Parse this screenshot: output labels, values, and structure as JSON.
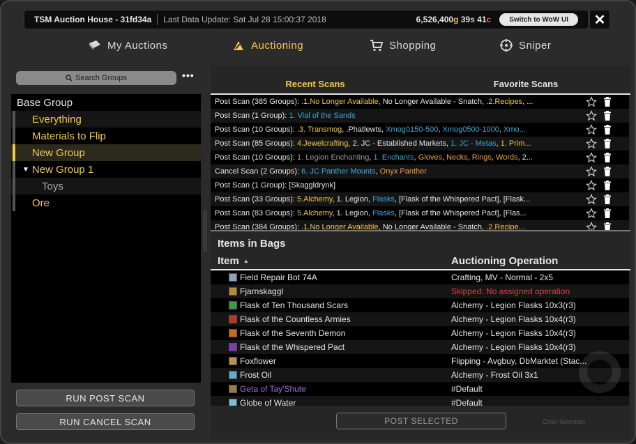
{
  "title_bar": {
    "app_title": "TSM Auction House - 31fd34a",
    "last_update": "Last Data Update: Sat Jul 28 15:00:37 2018",
    "gold_amount": "6,526,400",
    "gold_unit": "g",
    "silver_amount": "39",
    "silver_unit": "s",
    "copper_amount": "41",
    "copper_unit": "c",
    "switch_label": "Switch to WoW UI",
    "close_label": "✕"
  },
  "nav": {
    "tabs": [
      {
        "label": "My Auctions",
        "icon": "mail-icon",
        "active": false
      },
      {
        "label": "Auctioning",
        "icon": "gavel-icon",
        "active": true
      },
      {
        "label": "Shopping",
        "icon": "cart-icon",
        "active": false
      },
      {
        "label": "Sniper",
        "icon": "crosshair-icon",
        "active": false
      }
    ]
  },
  "groups": {
    "search_placeholder": "Search Groups",
    "more_label": "•••",
    "items": [
      {
        "label": "Base Group"
      },
      {
        "label": "Everything"
      },
      {
        "label": "Materials to Flip"
      },
      {
        "label": "New Group"
      },
      {
        "label": "New Group 1"
      },
      {
        "label": "Toys"
      },
      {
        "label": "Ore"
      }
    ]
  },
  "actions": {
    "run_post_scan": "RUN POST SCAN",
    "run_cancel_scan": "RUN CANCEL SCAN"
  },
  "scans": {
    "tabs": [
      "Recent Scans",
      "Favorite Scans"
    ],
    "rows": [
      {
        "segments": [
          {
            "t": "Post Scan (385 Groups): ",
            "c": "w"
          },
          {
            "t": ".1.No Longer Available",
            "c": "y"
          },
          {
            "t": ", No Longer Available - Snatch, ",
            "c": "w"
          },
          {
            "t": ".2.Recipes",
            "c": "y"
          },
          {
            "t": ", ...",
            "c": "w"
          }
        ]
      },
      {
        "segments": [
          {
            "t": "Post Scan (1 Group): ",
            "c": "w"
          },
          {
            "t": "1. Vial of the Sands",
            "c": "b"
          }
        ]
      },
      {
        "segments": [
          {
            "t": "Post Scan (10 Groups): ",
            "c": "w"
          },
          {
            "t": ".3. Transmog",
            "c": "y"
          },
          {
            "t": ", .Phatlewts, ",
            "c": "w"
          },
          {
            "t": "Xmog0150-500",
            "c": "b"
          },
          {
            "t": ", ",
            "c": "w"
          },
          {
            "t": "Xmog0500-1000",
            "c": "b"
          },
          {
            "t": ", ",
            "c": "w"
          },
          {
            "t": "Xmo...",
            "c": "b"
          }
        ]
      },
      {
        "segments": [
          {
            "t": "Post Scan (85 Groups): ",
            "c": "w"
          },
          {
            "t": "4.Jewelcrafting",
            "c": "y"
          },
          {
            "t": ", 2. JC - Established Markets, ",
            "c": "w"
          },
          {
            "t": "1. JC - Metas",
            "c": "b"
          },
          {
            "t": ", ",
            "c": "w"
          },
          {
            "t": "1. Prim...",
            "c": "y"
          }
        ]
      },
      {
        "segments": [
          {
            "t": "Post Scan (10 Groups): ",
            "c": "w"
          },
          {
            "t": "1. Legion Enchanting",
            "c": "g"
          },
          {
            "t": ", ",
            "c": "w"
          },
          {
            "t": "1. Enchants",
            "c": "b"
          },
          {
            "t": ", ",
            "c": "w"
          },
          {
            "t": "Gloves",
            "c": "o"
          },
          {
            "t": ", ",
            "c": "w"
          },
          {
            "t": "Necks",
            "c": "o"
          },
          {
            "t": ", ",
            "c": "w"
          },
          {
            "t": "Rings",
            "c": "o"
          },
          {
            "t": ", ",
            "c": "w"
          },
          {
            "t": "Words",
            "c": "o"
          },
          {
            "t": ", 2...",
            "c": "w"
          }
        ]
      },
      {
        "segments": [
          {
            "t": "Cancel Scan (2 Groups): ",
            "c": "w"
          },
          {
            "t": "6. JC Panther Mounts",
            "c": "b"
          },
          {
            "t": ", ",
            "c": "w"
          },
          {
            "t": "Onyx Panther",
            "c": "o"
          }
        ]
      },
      {
        "segments": [
          {
            "t": "Post Scan (1 Group): [Skaggldrynk]",
            "c": "w"
          }
        ]
      },
      {
        "segments": [
          {
            "t": "Post Scan (33 Groups): ",
            "c": "w"
          },
          {
            "t": "5.Alchemy",
            "c": "y"
          },
          {
            "t": ", 1. Legion, ",
            "c": "w"
          },
          {
            "t": "Flasks",
            "c": "b"
          },
          {
            "t": ", [Flask of the Whispered Pact], [Flask...",
            "c": "w"
          }
        ]
      },
      {
        "segments": [
          {
            "t": "Post Scan (83 Groups): ",
            "c": "w"
          },
          {
            "t": "5.Alchemy",
            "c": "y"
          },
          {
            "t": ", 1. Legion, ",
            "c": "w"
          },
          {
            "t": "Flasks",
            "c": "b"
          },
          {
            "t": ", [Flask of the Whispered Pact], [Flas...",
            "c": "w"
          }
        ]
      },
      {
        "segments": [
          {
            "t": "Post Scan (384 Groups): ",
            "c": "w"
          },
          {
            "t": ".1.No Longer Available",
            "c": "y"
          },
          {
            "t": ", No Longer Available - Snatch, ",
            "c": "w"
          },
          {
            "t": ".2.Recipe...",
            "c": "y"
          }
        ]
      }
    ]
  },
  "items": {
    "title": "Items in Bags",
    "col_item": "Item",
    "col_operation": "Auctioning Operation",
    "rows": [
      {
        "name": "Field Repair Bot 74A",
        "operation": "Crafting, MV - Normal - 2x5",
        "icon_color": "#8fa3c0"
      },
      {
        "name": "Fjarnskaggl",
        "operation": "Skipped: No assigned operation",
        "icon_color": "#b58a3a",
        "error": true
      },
      {
        "name": "Flask of Ten Thousand Scars",
        "operation": "Alchemy - Legion Flasks 10x3(r3)",
        "icon_color": "#3a9a4a"
      },
      {
        "name": "Flask of the Countless Armies",
        "operation": "Alchemy - Legion Flasks 10x4(r3)",
        "icon_color": "#c0302a"
      },
      {
        "name": "Flask of the Seventh Demon",
        "operation": "Alchemy - Legion Flasks 10x4(r3)",
        "icon_color": "#d06a1a"
      },
      {
        "name": "Flask of the Whispered Pact",
        "operation": "Alchemy - Legion Flasks 10x4(r3)",
        "icon_color": "#7a3ab0"
      },
      {
        "name": "Foxflower",
        "operation": "Flipping - Avgbuy, DbMarktet (Stac...",
        "icon_color": "#c08a5a"
      },
      {
        "name": "Frost Oil",
        "operation": "Alchemy - Frost Oil 3x1",
        "icon_color": "#5ab0d0"
      },
      {
        "name": "Geta of Tay'Shute",
        "operation": "#Default",
        "icon_color": "#9a7a4a",
        "epic": true
      },
      {
        "name": "Globe of Water",
        "operation": "#Default",
        "icon_color": "#7ac0d8"
      }
    ],
    "post_selected": "POST SELECTED",
    "clear_selection": "Clear Selection"
  },
  "colors": {
    "accent": "#f2c94c",
    "link_blue": "#3fa9d9",
    "orange": "#f0a040",
    "epic": "#a66de0",
    "error": "#e04040"
  }
}
